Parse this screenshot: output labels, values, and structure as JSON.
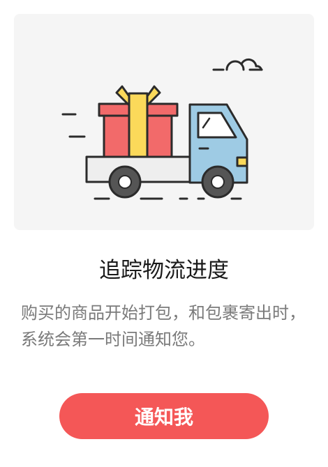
{
  "illustration": {
    "icon": "delivery-truck-gift-icon",
    "colors": {
      "card_background": "#f5f5f5",
      "gift_box": "#f26a6a",
      "ribbon": "#fbd95a",
      "truck_cab": "#9ecbe4",
      "truck_bed": "#eeeeee",
      "outline": "#2b2b2b"
    }
  },
  "title": "追踪物流进度",
  "description": "购买的商品开始打包，和包裹寄出时，系统会第一时间通知您。",
  "button": {
    "label": "通知我",
    "color": "#f45757"
  }
}
